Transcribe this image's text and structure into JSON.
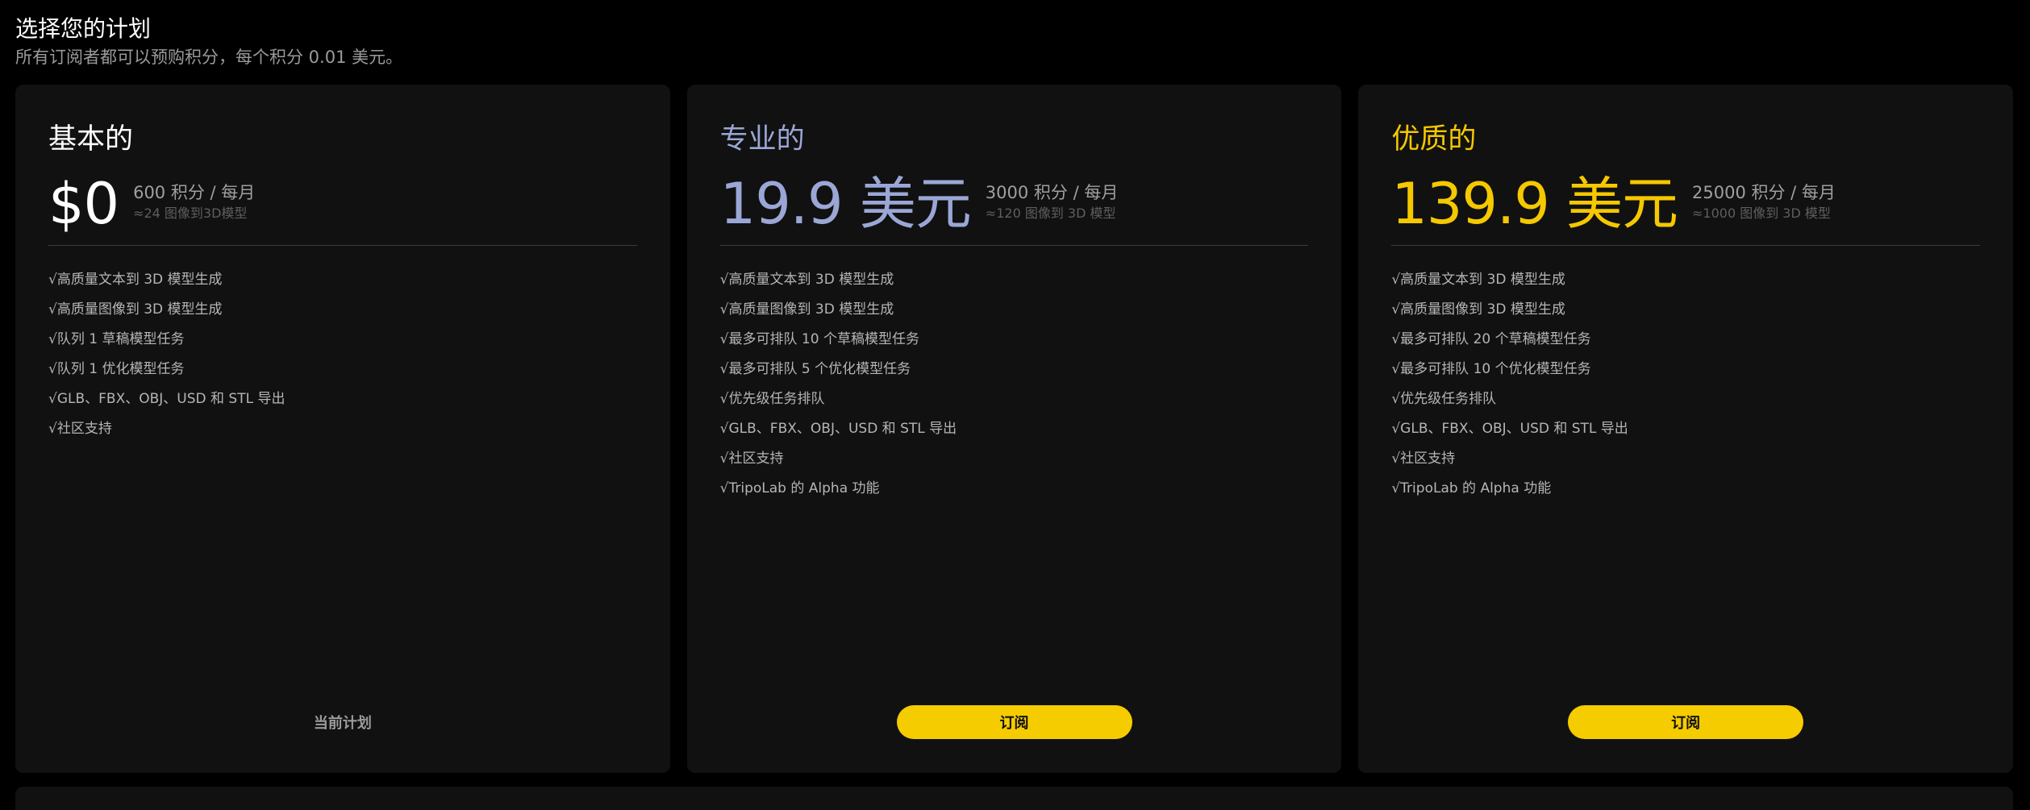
{
  "header": {
    "title": "选择您的计划",
    "subtitle": "所有订阅者都可以预购积分，每个积分 0.01 美元。"
  },
  "colors": {
    "background": "#000000",
    "card": "#111111",
    "basic_accent": "#ffffff",
    "pro_accent": "#9aa7d6",
    "premium_accent": "#f5c800",
    "button": "#f5cc00"
  },
  "plans": [
    {
      "name": "基本的",
      "price": "$0",
      "credits": "600 积分 / 每月",
      "approx": "≈24 图像到3D模型",
      "features": [
        "√高质量文本到 3D 模型生成",
        "√高质量图像到 3D 模型生成",
        "√队列 1 草稿模型任务",
        "√队列 1 优化模型任务",
        "√GLB、FBX、OBJ、USD 和 STL 导出",
        "√社区支持"
      ],
      "action_label": "当前计划",
      "action_type": "current"
    },
    {
      "name": "专业的",
      "price": "19.9 美元",
      "credits": "3000 积分 / 每月",
      "approx": "≈120 图像到 3D 模型",
      "features": [
        "√高质量文本到 3D 模型生成",
        "√高质量图像到 3D 模型生成",
        "√最多可排队 10 个草稿模型任务",
        "√最多可排队 5 个优化模型任务",
        "√优先级任务排队",
        "√GLB、FBX、OBJ、USD 和 STL 导出",
        "√社区支持",
        "√TripoLab 的 Alpha 功能"
      ],
      "action_label": "订阅",
      "action_type": "subscribe"
    },
    {
      "name": "优质的",
      "price": "139.9 美元",
      "credits": "25000 积分 / 每月",
      "approx": "≈1000 图像到 3D 模型",
      "features": [
        "√高质量文本到 3D 模型生成",
        "√高质量图像到 3D 模型生成",
        "√最多可排队 20 个草稿模型任务",
        "√最多可排队 10 个优化模型任务",
        "√优先级任务排队",
        "√GLB、FBX、OBJ、USD 和 STL 导出",
        "√社区支持",
        "√TripoLab 的 Alpha 功能"
      ],
      "action_label": "订阅",
      "action_type": "subscribe"
    }
  ]
}
